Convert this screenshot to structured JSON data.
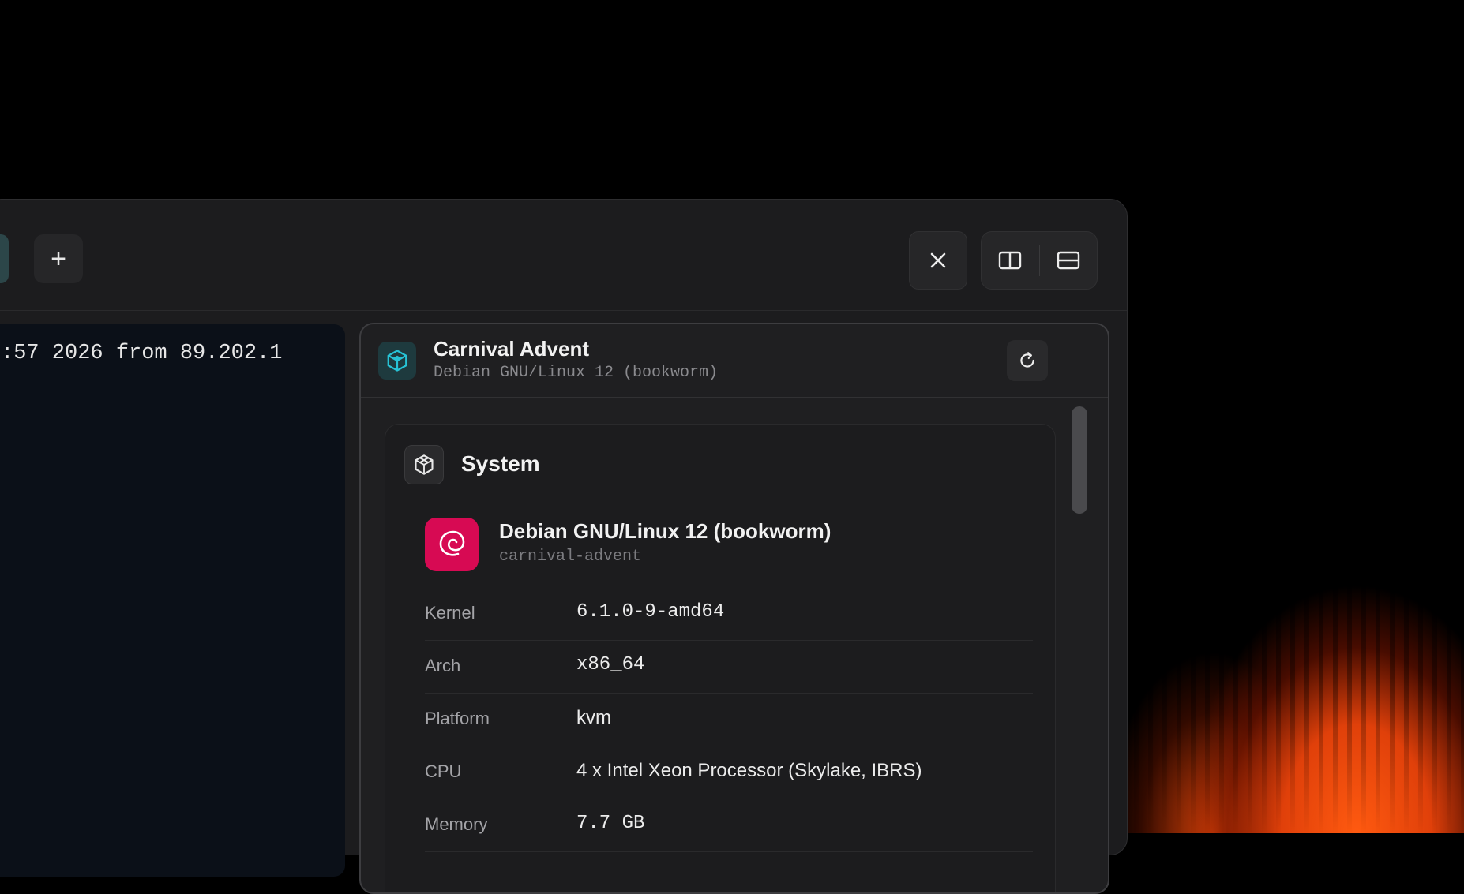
{
  "tabs": {
    "close_glyph": "✕",
    "add_glyph": "+"
  },
  "toolbar": {
    "close_glyph": "✕"
  },
  "terminal": {
    "line": ":57 2026 from 89.202.1"
  },
  "host": {
    "name": "Carnival Advent",
    "os": "Debian GNU/Linux 12 (bookworm)",
    "accent": "#27c3d6"
  },
  "system": {
    "title": "System",
    "os_name": "Debian GNU/Linux 12 (bookworm)",
    "hostname": "carnival-advent",
    "logo_color": "#d70a53",
    "rows": [
      {
        "key": "Kernel",
        "value": "6.1.0-9-amd64"
      },
      {
        "key": "Arch",
        "value": "x86_64"
      },
      {
        "key": "Platform",
        "value": "kvm"
      },
      {
        "key": "CPU",
        "value": "4 x Intel Xeon Processor (Skylake, IBRS)"
      },
      {
        "key": "Memory",
        "value": "7.7 GB"
      }
    ]
  }
}
